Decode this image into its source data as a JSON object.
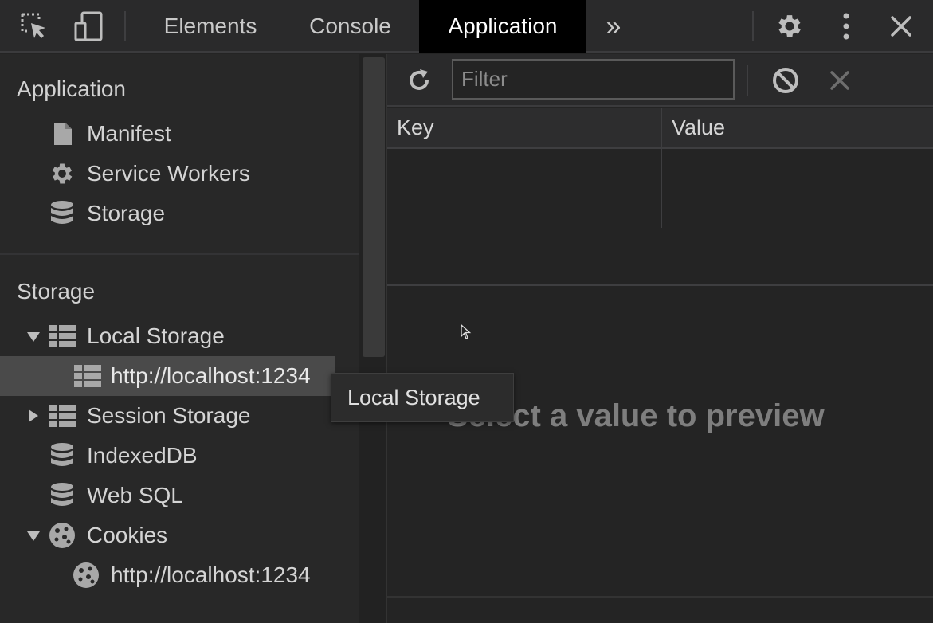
{
  "topbar": {
    "tabs": [
      {
        "label": "Elements",
        "active": false
      },
      {
        "label": "Console",
        "active": false
      },
      {
        "label": "Application",
        "active": true
      }
    ],
    "more_tabs_glyph": "»"
  },
  "sidebar": {
    "application_title": "Application",
    "application_items": [
      {
        "label": "Manifest",
        "icon": "file-icon"
      },
      {
        "label": "Service Workers",
        "icon": "gear-icon"
      },
      {
        "label": "Storage",
        "icon": "database-icon"
      }
    ],
    "storage_title": "Storage",
    "storage_items": [
      {
        "label": "Local Storage",
        "icon": "grid-icon",
        "expanded": true
      },
      {
        "label": "http://localhost:1234",
        "icon": "grid-icon",
        "selected": true
      },
      {
        "label": "Session Storage",
        "icon": "grid-icon",
        "expanded": false
      },
      {
        "label": "IndexedDB",
        "icon": "database-icon"
      },
      {
        "label": "Web SQL",
        "icon": "database-icon"
      },
      {
        "label": "Cookies",
        "icon": "cookie-icon",
        "expanded": true
      },
      {
        "label": "http://localhost:1234",
        "icon": "cookie-icon"
      }
    ]
  },
  "main": {
    "filter_placeholder": "Filter",
    "columns": [
      "Key",
      "Value"
    ],
    "preview_text": "Select a value to preview"
  },
  "tooltip": {
    "text": "Local Storage"
  },
  "colors": {
    "background": "#242424",
    "toolbar": "#2a2a2b",
    "active_tab": "#000000",
    "selected_row": "#4a4a4a"
  }
}
